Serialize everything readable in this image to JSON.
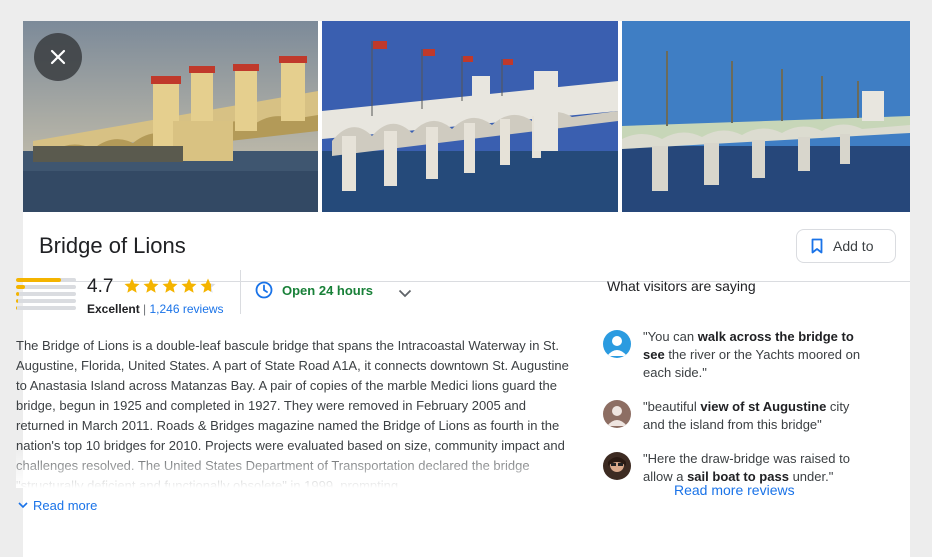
{
  "place": {
    "title": "Bridge of Lions",
    "add_to_label": "Add to"
  },
  "rating": {
    "score": "4.7",
    "stars": 4.7,
    "label": "Excellent",
    "separator": " | ",
    "reviews_link": "1,246 reviews",
    "distribution": [
      0.75,
      0.15,
      0.05,
      0.03,
      0.02
    ]
  },
  "hours": {
    "status": "Open 24 hours"
  },
  "description": {
    "text": "The Bridge of Lions is a double-leaf bascule bridge that spans the Intracoastal Waterway in St. Augustine, Florida, United States. A part of State Road A1A, it connects downtown St. Augustine to Anastasia Island across Matanzas Bay. A pair of copies of the marble Medici lions guard the bridge, begun in 1925 and completed in 1927. They were removed in February 2005 and returned in March 2011. Roads & Bridges magazine named the Bridge of Lions as fourth in the nation's top 10 bridges for 2010. Projects were evaluated based on size, community impact and challenges resolved. The United States Department of Transportation declared the bridge \"structurally deficient and functionally obsolete\" in 1999, prompting",
    "read_more": "Read more"
  },
  "visitors": {
    "title": "What visitors are saying",
    "reviews": [
      {
        "pre": "\"You can ",
        "bold": "walk across the bridge to see",
        "post": " the river or the Yachts moored on each side.\""
      },
      {
        "pre": "\"beautiful ",
        "bold": "view of st Augustine",
        "post": " city and the island from this bridge\""
      },
      {
        "pre": "\"Here the draw-bridge was raised to allow a ",
        "bold": "sail boat to pass",
        "post": " under.\""
      }
    ],
    "read_more_reviews": "Read more reviews"
  },
  "colors": {
    "accent_blue": "#1a73e8",
    "star_yellow": "#f4b400",
    "open_green": "#188038"
  }
}
